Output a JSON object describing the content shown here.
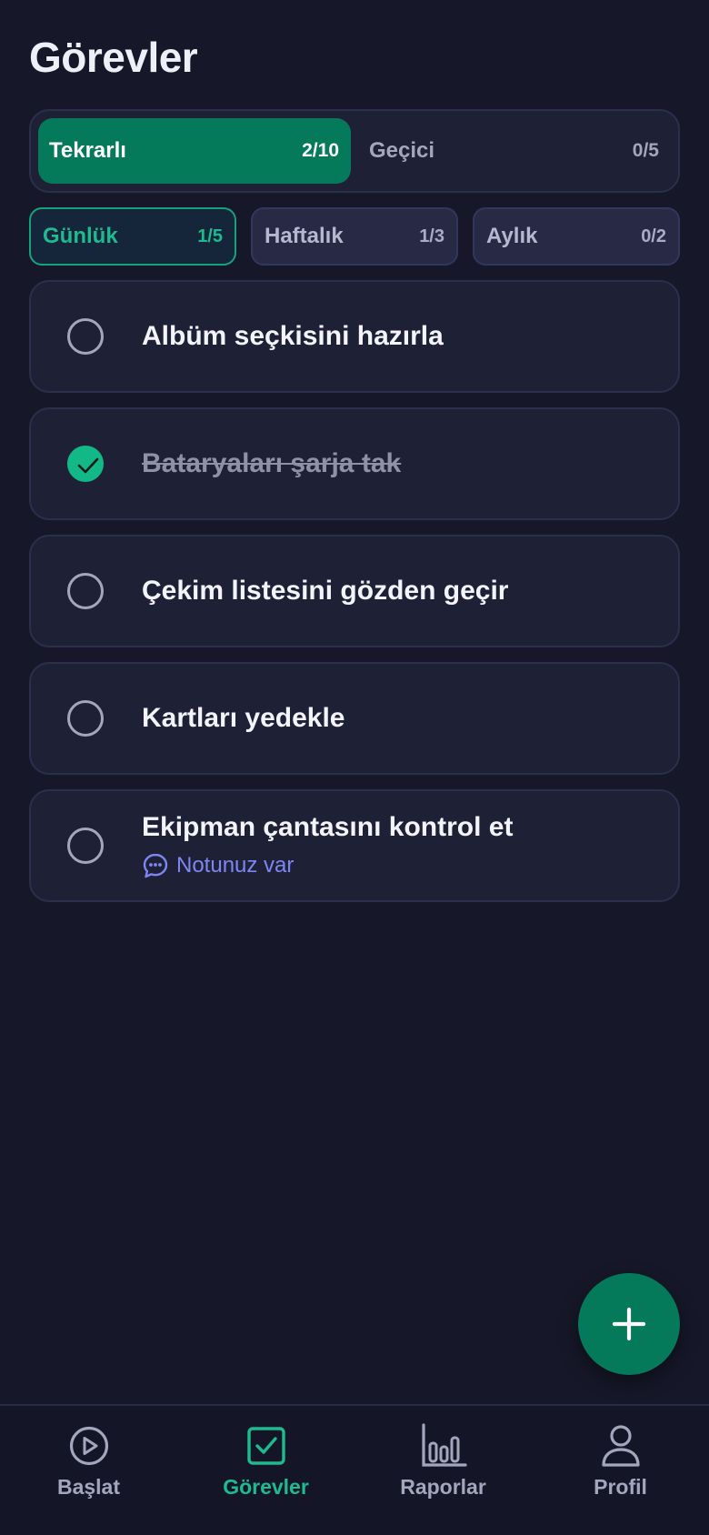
{
  "page": {
    "title": "Görevler"
  },
  "segments": [
    {
      "label": "Tekrarlı",
      "count": "2/10",
      "active": true
    },
    {
      "label": "Geçici",
      "count": "0/5",
      "active": false
    }
  ],
  "filters": [
    {
      "label": "Günlük",
      "count": "1/5",
      "active": true
    },
    {
      "label": "Haftalık",
      "count": "1/3",
      "active": false
    },
    {
      "label": "Aylık",
      "count": "0/2",
      "active": false
    }
  ],
  "tasks": [
    {
      "title": "Albüm seçkisini hazırla",
      "done": false
    },
    {
      "title": "Bataryaları şarja tak",
      "done": true
    },
    {
      "title": "Çekim listesini gözden geçir",
      "done": false
    },
    {
      "title": "Kartları yedekle",
      "done": false
    },
    {
      "title": "Ekipman çantasını kontrol et",
      "done": false,
      "note": "Notunuz var"
    }
  ],
  "fab": {
    "icon": "plus-icon"
  },
  "tabbar": [
    {
      "label": "Başlat",
      "icon": "play-circle-icon",
      "active": false
    },
    {
      "label": "Görevler",
      "icon": "check-square-icon",
      "active": true
    },
    {
      "label": "Raporlar",
      "icon": "bar-chart-icon",
      "active": false
    },
    {
      "label": "Profil",
      "icon": "user-icon",
      "active": false
    }
  ],
  "colors": {
    "background": "#161829",
    "accent": "#057a5b",
    "accent_text": "#1dbb8f",
    "note_link": "#7d86f2"
  }
}
